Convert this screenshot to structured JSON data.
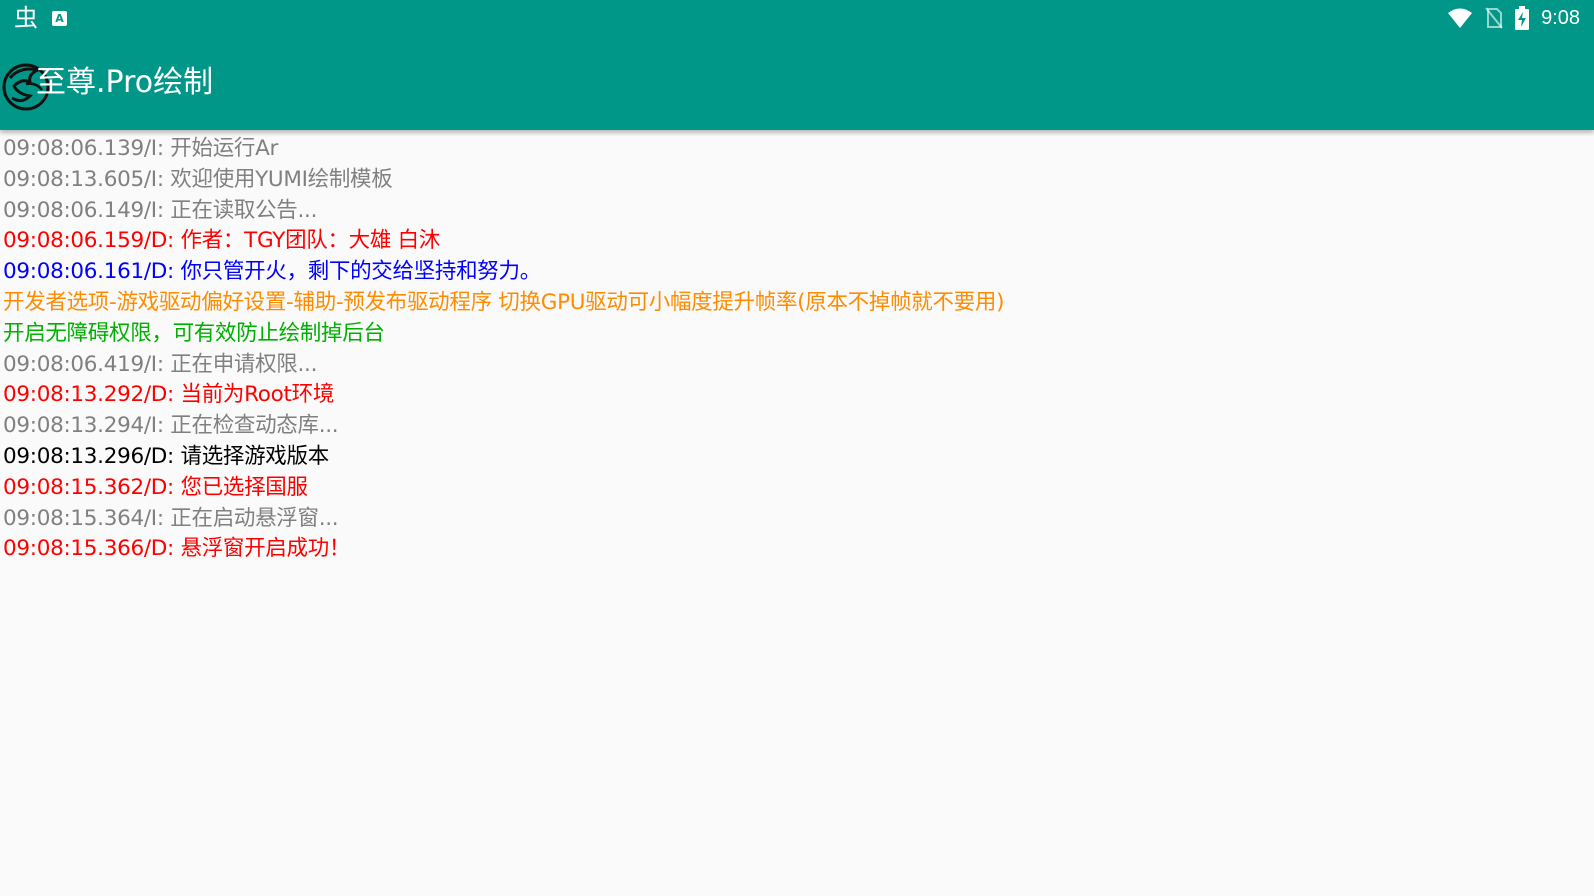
{
  "status_bar": {
    "time": "9:08",
    "icons": [
      "bug-icon",
      "a-notification-icon",
      "wifi-icon",
      "no-sim-icon",
      "battery-charging-icon"
    ],
    "bug_glyph": "虫",
    "a_glyph": "A"
  },
  "app_bar": {
    "title": "至尊.Pro绘制",
    "logo_icon": "app-logo-icon",
    "background_color": "#009688"
  },
  "log": {
    "lines": [
      {
        "text": "09:08:06.139/I: 开始运行Ar",
        "color": "#808080"
      },
      {
        "text": "09:08:13.605/I: 欢迎使用YUMI绘制模板",
        "color": "#808080"
      },
      {
        "text": "09:08:06.149/I: 正在读取公告...",
        "color": "#808080"
      },
      {
        "text": "09:08:06.159/D: 作者：TGY团队：大雄 白沐",
        "color": "#ff0000"
      },
      {
        "text": "09:08:06.161/D: 你只管开火，剩下的交给坚持和努力。",
        "color": "#0000ff"
      },
      {
        "text": "开发者选项-游戏驱动偏好设置-辅助-预发布驱动程序 切换GPU驱动可小幅度提升帧率(原本不掉帧就不要用)",
        "color": "#ff8c00"
      },
      {
        "text": "开启无障碍权限，可有效防止绘制掉后台",
        "color": "#00b000"
      },
      {
        "text": "09:08:06.419/I: 正在申请权限...",
        "color": "#808080"
      },
      {
        "text": "09:08:13.292/D: 当前为Root环境",
        "color": "#ff0000"
      },
      {
        "text": "09:08:13.294/I: 正在检查动态库...",
        "color": "#808080"
      },
      {
        "text": "09:08:13.296/D: 请选择游戏版本",
        "color": "#000000"
      },
      {
        "text": "09:08:15.362/D: 您已选择国服",
        "color": "#ff0000"
      },
      {
        "text": "09:08:15.364/I: 正在启动悬浮窗...",
        "color": "#808080"
      },
      {
        "text": "09:08:15.366/D: 悬浮窗开启成功！",
        "color": "#ff0000"
      }
    ]
  }
}
